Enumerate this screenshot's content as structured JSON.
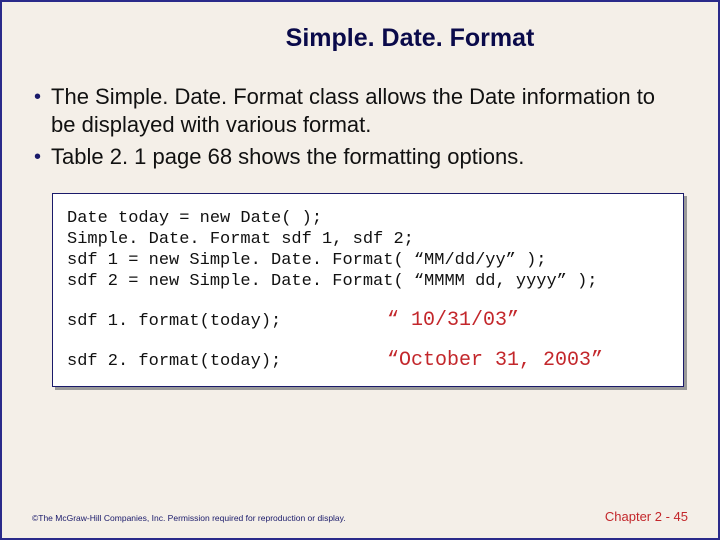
{
  "title": "Simple. Date. Format",
  "bullets": [
    "The Simple. Date. Format class allows the Date information to be displayed with various format.",
    "Table 2. 1 page 68 shows the formatting options."
  ],
  "code": {
    "l1": "Date today = new Date( );",
    "l2": "Simple. Date. Format sdf 1, sdf 2;",
    "l3": "sdf 1 = new Simple. Date. Format( “MM/dd/yy” );",
    "l4": "sdf 2 = new Simple. Date. Format( “MMMM dd, yyyy” );",
    "r1l": "sdf 1. format(today);",
    "r1r": "“ 10/31/03”",
    "r2l": "sdf 2. format(today);",
    "r2r": "“October 31, 2003”"
  },
  "footer": {
    "copyright": "©The McGraw-Hill Companies, Inc. Permission required for reproduction or display.",
    "page": "Chapter 2 - 45"
  }
}
